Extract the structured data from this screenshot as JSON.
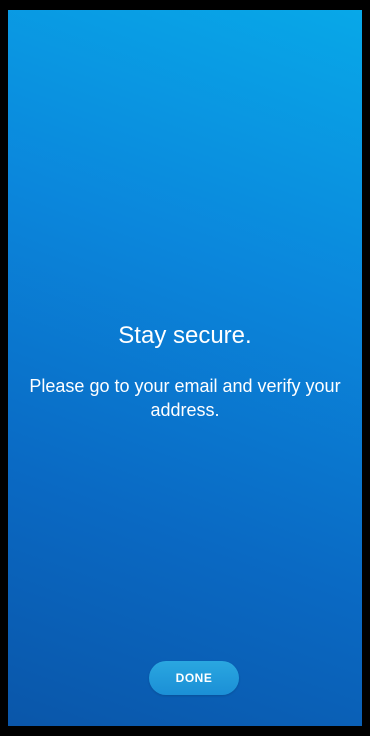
{
  "screen": {
    "title": "Stay secure.",
    "message": "Please go to your email and verify your address.",
    "done_label": "DONE"
  },
  "colors": {
    "gradient_top": "#08a8e8",
    "gradient_bottom": "#0a56a9",
    "button": "#1b8fd6",
    "text": "#ffffff"
  }
}
